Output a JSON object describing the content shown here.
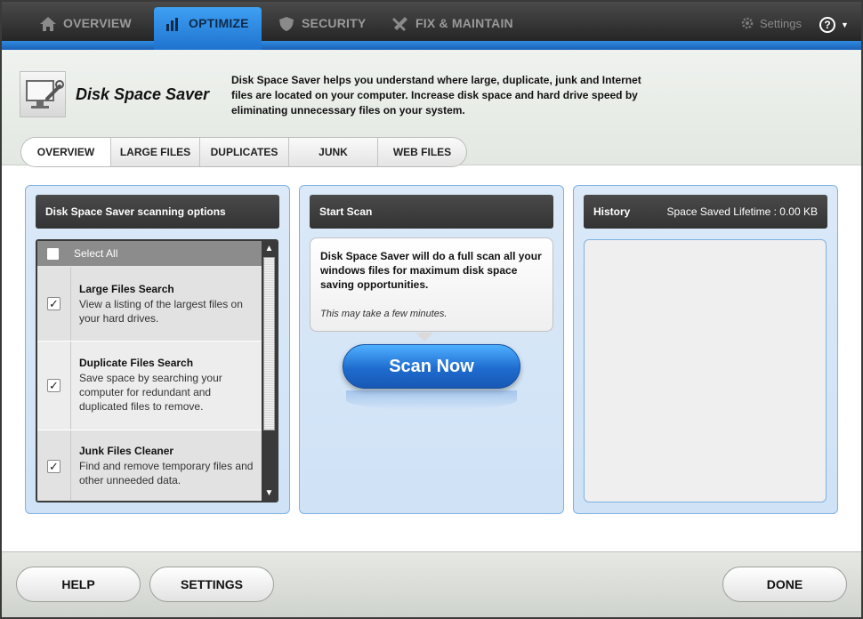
{
  "nav": {
    "tabs": [
      {
        "label": "OVERVIEW",
        "icon": "home-icon"
      },
      {
        "label": "OPTIMIZE",
        "icon": "bar-chart-icon"
      },
      {
        "label": "SECURITY",
        "icon": "shield-icon"
      },
      {
        "label": "FIX & MAINTAIN",
        "icon": "tools-icon"
      }
    ],
    "settings_label": "Settings",
    "help_label": "?"
  },
  "header": {
    "title": "Disk Space Saver",
    "description": "Disk Space Saver helps you understand where large, duplicate, junk and Internet files are located on your computer.  Increase disk space and hard drive speed by eliminating unnecessary files on your system."
  },
  "subtabs": [
    "OVERVIEW",
    "LARGE FILES",
    "DUPLICATES",
    "JUNK",
    "WEB FILES"
  ],
  "options_panel": {
    "heading": "Disk Space Saver scanning options",
    "select_all": "Select All",
    "items": [
      {
        "title": "Large Files Search",
        "desc": "View a listing of the largest files on your hard drives.",
        "checked": true
      },
      {
        "title": "Duplicate Files Search",
        "desc": "Save space by searching your computer for redundant and duplicated files to remove.",
        "checked": true
      },
      {
        "title": "Junk Files Cleaner",
        "desc": "Find and remove temporary files and other unneeded data.",
        "checked": true
      }
    ]
  },
  "scan_panel": {
    "heading": "Start Scan",
    "text": "Disk Space Saver will do a full scan all your windows files for maximum disk space saving opportunities.",
    "note": "This may take a few minutes.",
    "button": "Scan Now"
  },
  "history_panel": {
    "heading": "History",
    "lifetime_label": "Space Saved Lifetime :",
    "lifetime_value": "0.00 KB"
  },
  "footer": {
    "help": "HELP",
    "settings": "SETTINGS",
    "done": "DONE"
  },
  "colors": {
    "accent_blue": "#1f73cf",
    "nav_dark": "#2c2c2c",
    "panel_blue": "#d6e7f7"
  }
}
